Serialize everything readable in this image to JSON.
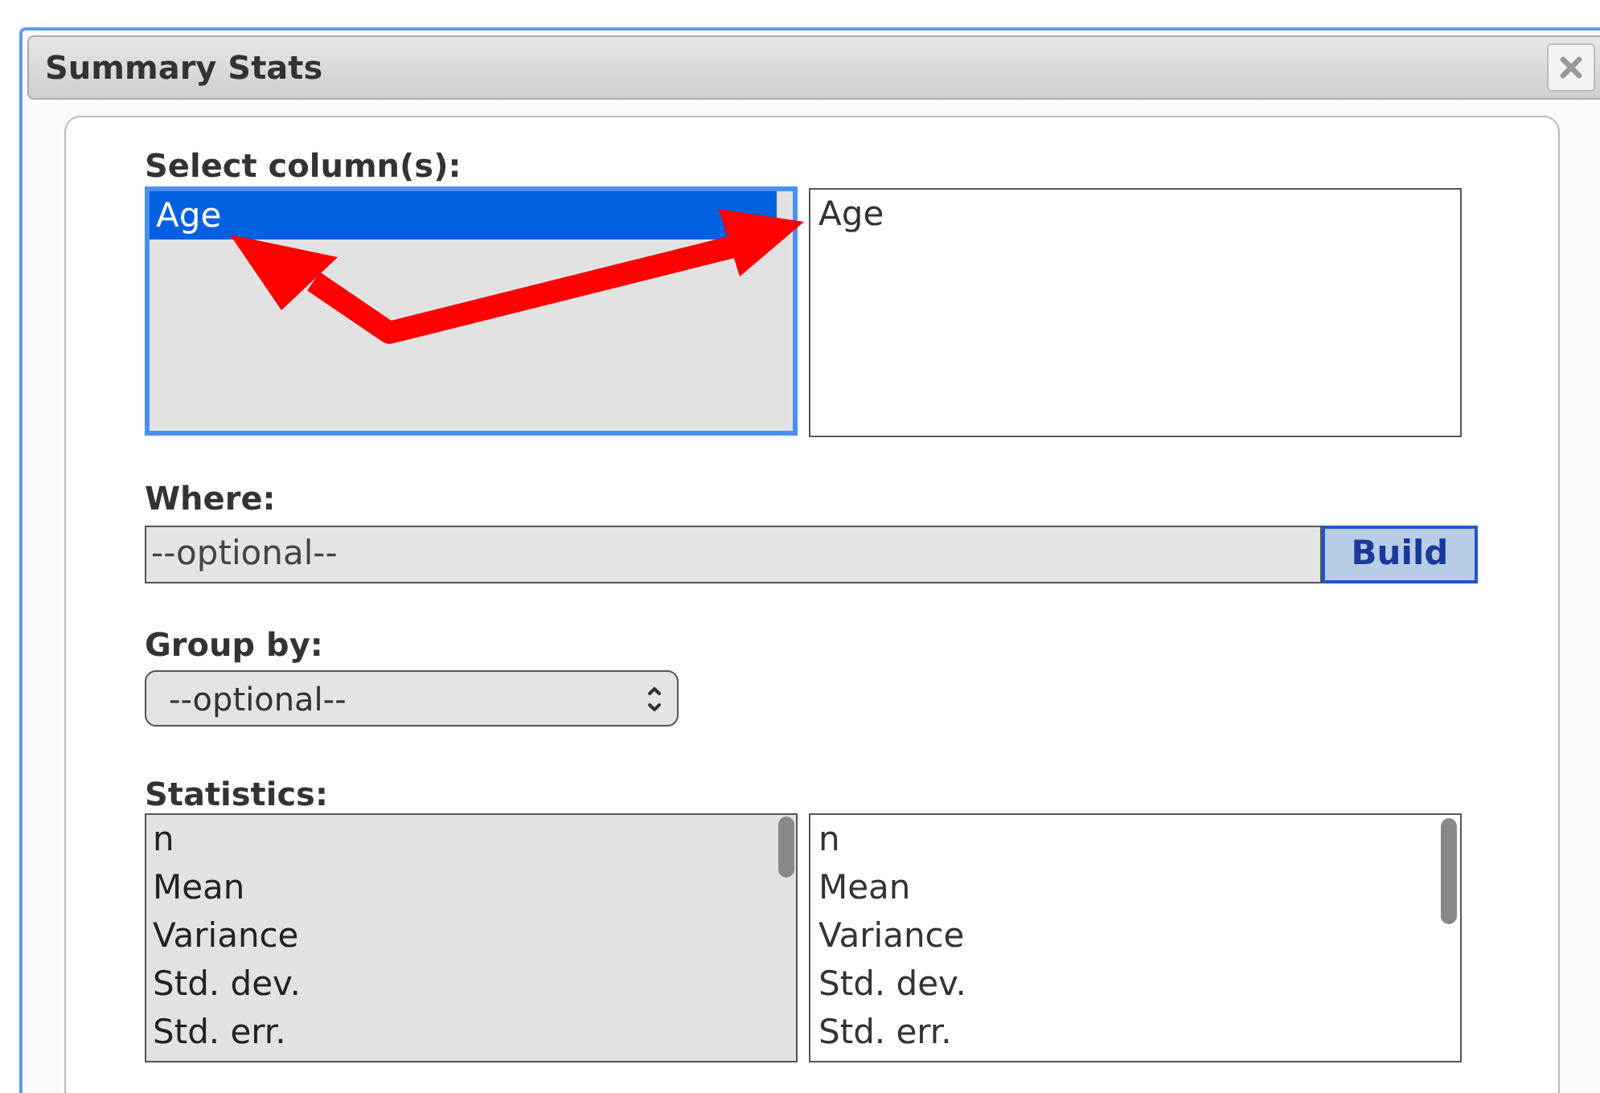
{
  "dialog": {
    "title": "Summary Stats",
    "select_columns": {
      "label": "Select column(s):",
      "available": [
        {
          "text": "Age",
          "selected": true
        }
      ],
      "chosen": [
        {
          "text": "Age"
        }
      ]
    },
    "where": {
      "label": "Where:",
      "placeholder": "--optional--",
      "button": "Build"
    },
    "group_by": {
      "label": "Group by:",
      "value": "--optional--"
    },
    "statistics": {
      "label": "Statistics:",
      "available": [
        {
          "text": "n",
          "selected": false
        },
        {
          "text": "Mean",
          "selected": false
        },
        {
          "text": "Variance",
          "selected": false
        },
        {
          "text": "Std. dev.",
          "selected": false
        },
        {
          "text": "Std. err.",
          "selected": false
        }
      ],
      "chosen": [
        {
          "text": "n"
        },
        {
          "text": "Mean"
        },
        {
          "text": "Variance"
        },
        {
          "text": "Std. dev."
        },
        {
          "text": "Std. err."
        }
      ]
    }
  }
}
